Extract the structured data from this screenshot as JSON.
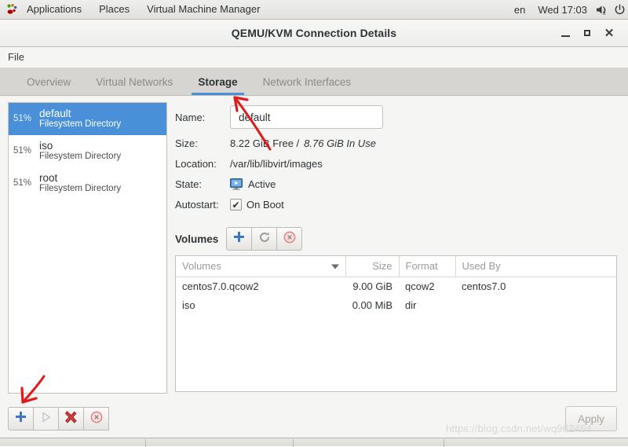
{
  "top_panel": {
    "activities": "Applications",
    "places": "Places",
    "app_name": "Virtual Machine Manager",
    "language": "en",
    "clock": "Wed 17:03",
    "logo_icon": "gnome-foot-icon",
    "volume_icon": "volume-muted-icon",
    "power_icon": "power-icon"
  },
  "window": {
    "title": "QEMU/KVM Connection Details",
    "minimize_icon": "minimize-icon",
    "maximize_icon": "maximize-icon",
    "close_icon": "close-icon"
  },
  "menubar": {
    "items": [
      {
        "label": "File"
      }
    ]
  },
  "tabs": [
    {
      "label": "Overview",
      "active": false
    },
    {
      "label": "Virtual Networks",
      "active": false
    },
    {
      "label": "Storage",
      "active": true
    },
    {
      "label": "Network Interfaces",
      "active": false
    }
  ],
  "pool_list": [
    {
      "percent": "51%",
      "name": "default",
      "type": "Filesystem Directory",
      "selected": true
    },
    {
      "percent": "51%",
      "name": "iso",
      "type": "Filesystem Directory",
      "selected": false
    },
    {
      "percent": "51%",
      "name": "root",
      "type": "Filesystem Directory",
      "selected": false
    }
  ],
  "details": {
    "name_label": "Name:",
    "name_value": "default",
    "size_label": "Size:",
    "size_free": "8.22 GiB Free /",
    "size_used": "8.76 GiB In Use",
    "location_label": "Location:",
    "location_value": "/var/lib/libvirt/images",
    "state_label": "State:",
    "state_value": "Active",
    "state_icon": "active-monitor-icon",
    "autostart_label": "Autostart:",
    "autostart_value": "On Boot",
    "autostart_checked": true
  },
  "volumes_toolbar": {
    "title": "Volumes",
    "add_icon": "plus-icon",
    "refresh_icon": "refresh-icon",
    "delete_icon": "delete-circle-icon"
  },
  "volumes_table": {
    "columns": [
      "Volumes",
      "Size",
      "Format",
      "Used By"
    ],
    "sort_icon": "sort-descending-arrow-icon",
    "rows": [
      {
        "volume": "centos7.0.qcow2",
        "size": "9.00 GiB",
        "format": "qcow2",
        "used_by": "centos7.0"
      },
      {
        "volume": "iso",
        "size": "0.00 MiB",
        "format": "dir",
        "used_by": ""
      }
    ]
  },
  "bottom_toolbar": {
    "add_pool_icon": "plus-icon",
    "start_pool_icon": "play-icon",
    "stop_pool_icon": "red-x-icon",
    "delete_pool_icon": "delete-circle-icon",
    "apply_label": "Apply"
  },
  "watermark": {
    "text": "https://blog.csdn.net/wq962464"
  },
  "colors": {
    "accent_blue": "#4a90d9",
    "selection_blue": "#4a90d9",
    "annotation_red": "#e01b1b",
    "panel_gray": "#e2e1de",
    "tabbar_gray": "#d6d5d1"
  }
}
